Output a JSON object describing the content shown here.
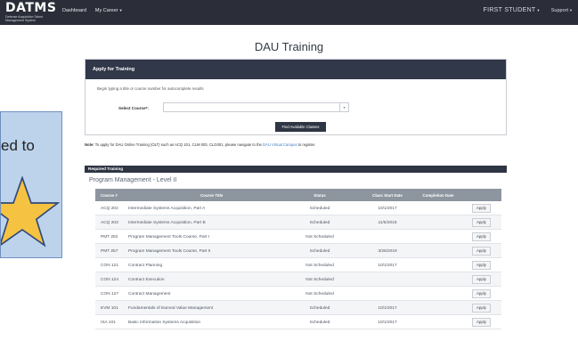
{
  "nav": {
    "logo_title": "DATMS",
    "logo_sub_1": "Defense Acquisition Talent",
    "logo_sub_2": "Management System",
    "dashboard": "Dashboard",
    "my_career": "My Career",
    "user": "FIRST STUDENT",
    "support": "Support"
  },
  "page_title": "DAU Training",
  "apply": {
    "header": "Apply for Training",
    "hint": "Begin typing a title or course number for autocomplete results",
    "select_label": "Select Course*:",
    "select_value": "",
    "find_button": "Find Available Classes"
  },
  "note": {
    "label": "Note:",
    "text": "To apply for DAU Online Training (OLT) such as ACQ 101, CLM 003, CLG001, please navigate to the",
    "link": "DAU Virtual Campus",
    "suffix": "to register."
  },
  "required": {
    "header": "Required Training",
    "track": "Program Management - Level II",
    "columns": {
      "num": "Course #",
      "title": "Course Title",
      "status": "Status",
      "start": "Class Start Date",
      "completion": "Completion Date"
    },
    "apply_label": "Apply",
    "rows": [
      {
        "num": "ACQ 202",
        "title": "Intermediate Systems Acquisition, Part A",
        "status": "Scheduled",
        "start": "10/1/2017",
        "completion": ""
      },
      {
        "num": "ACQ 203",
        "title": "Intermediate Systems Acquisition, Part B",
        "status": "Scheduled",
        "start": "11/5/2018",
        "completion": ""
      },
      {
        "num": "PMT 252",
        "title": "Program Management Tools Course, Part I",
        "status": "Not Scheduled",
        "start": "",
        "completion": ""
      },
      {
        "num": "PMT 257",
        "title": "Program Management Tools Course, Part II",
        "status": "Scheduled",
        "start": "3/25/2019",
        "completion": ""
      },
      {
        "num": "CON 121",
        "title": "Contract Planning",
        "status": "Not Scheduled",
        "start": "10/1/2017",
        "completion": ""
      },
      {
        "num": "CON 124",
        "title": "Contract Execution",
        "status": "Not Scheduled",
        "start": "",
        "completion": ""
      },
      {
        "num": "CON 127",
        "title": "Contract Management",
        "status": "Not Scheduled",
        "start": "",
        "completion": ""
      },
      {
        "num": "EVM 101",
        "title": "Fundamentals of Earned Value Management",
        "status": "Scheduled",
        "start": "10/1/2017",
        "completion": ""
      },
      {
        "num": "ISA 101",
        "title": "Basic Information Systems Acquisition",
        "status": "Scheduled",
        "start": "10/1/2017",
        "completion": ""
      }
    ]
  },
  "callout": {
    "text": "ed to"
  },
  "colors": {
    "nav_bg": "#2b2e38",
    "panel_header": "#313849",
    "table_header": "#8d959f",
    "link": "#3f7fc8",
    "callout_bg": "#bdd3ec",
    "star_fill": "#f5c242"
  }
}
